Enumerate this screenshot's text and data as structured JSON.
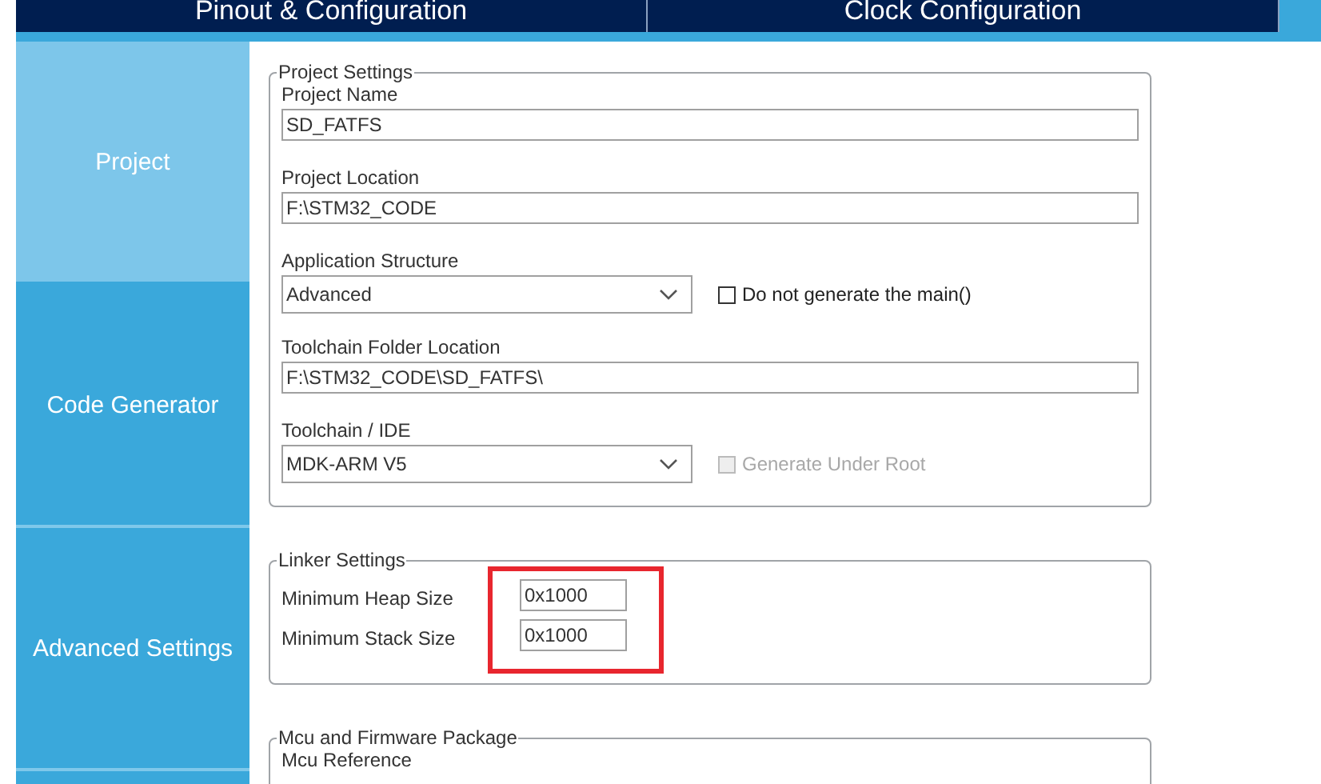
{
  "tabs": [
    {
      "label": "Pinout & Configuration"
    },
    {
      "label": "Clock Configuration"
    }
  ],
  "sidebar": {
    "items": [
      {
        "label": "Project",
        "selected": true
      },
      {
        "label": "Code Generator",
        "selected": false
      },
      {
        "label": "Advanced Settings",
        "selected": false
      }
    ]
  },
  "project_settings": {
    "legend": "Project Settings",
    "fields": [
      {
        "kind": "text",
        "label": "Project Name",
        "value": "SD_FATFS"
      },
      {
        "kind": "text",
        "label": "Project Location",
        "value": "F:\\STM32_CODE"
      },
      {
        "kind": "select",
        "label": "Application Structure",
        "value": "Advanced",
        "checkbox": {
          "label": "Do not generate the main()",
          "checked": false,
          "disabled": false
        }
      },
      {
        "kind": "text",
        "label": "Toolchain Folder Location",
        "value": "F:\\STM32_CODE\\SD_FATFS\\"
      },
      {
        "kind": "select",
        "label": "Toolchain / IDE",
        "value": "MDK-ARM V5",
        "checkbox": {
          "label": "Generate Under Root",
          "checked": false,
          "disabled": true
        }
      }
    ]
  },
  "linker_settings": {
    "legend": "Linker Settings",
    "highlighted": true,
    "fields": [
      {
        "label": "Minimum Heap Size",
        "value": "0x1000"
      },
      {
        "label": "Minimum Stack Size",
        "value": "0x1000"
      }
    ]
  },
  "mcu_package": {
    "legend": "Mcu and Firmware Package",
    "fields": [
      {
        "label": "Mcu Reference"
      }
    ]
  }
}
